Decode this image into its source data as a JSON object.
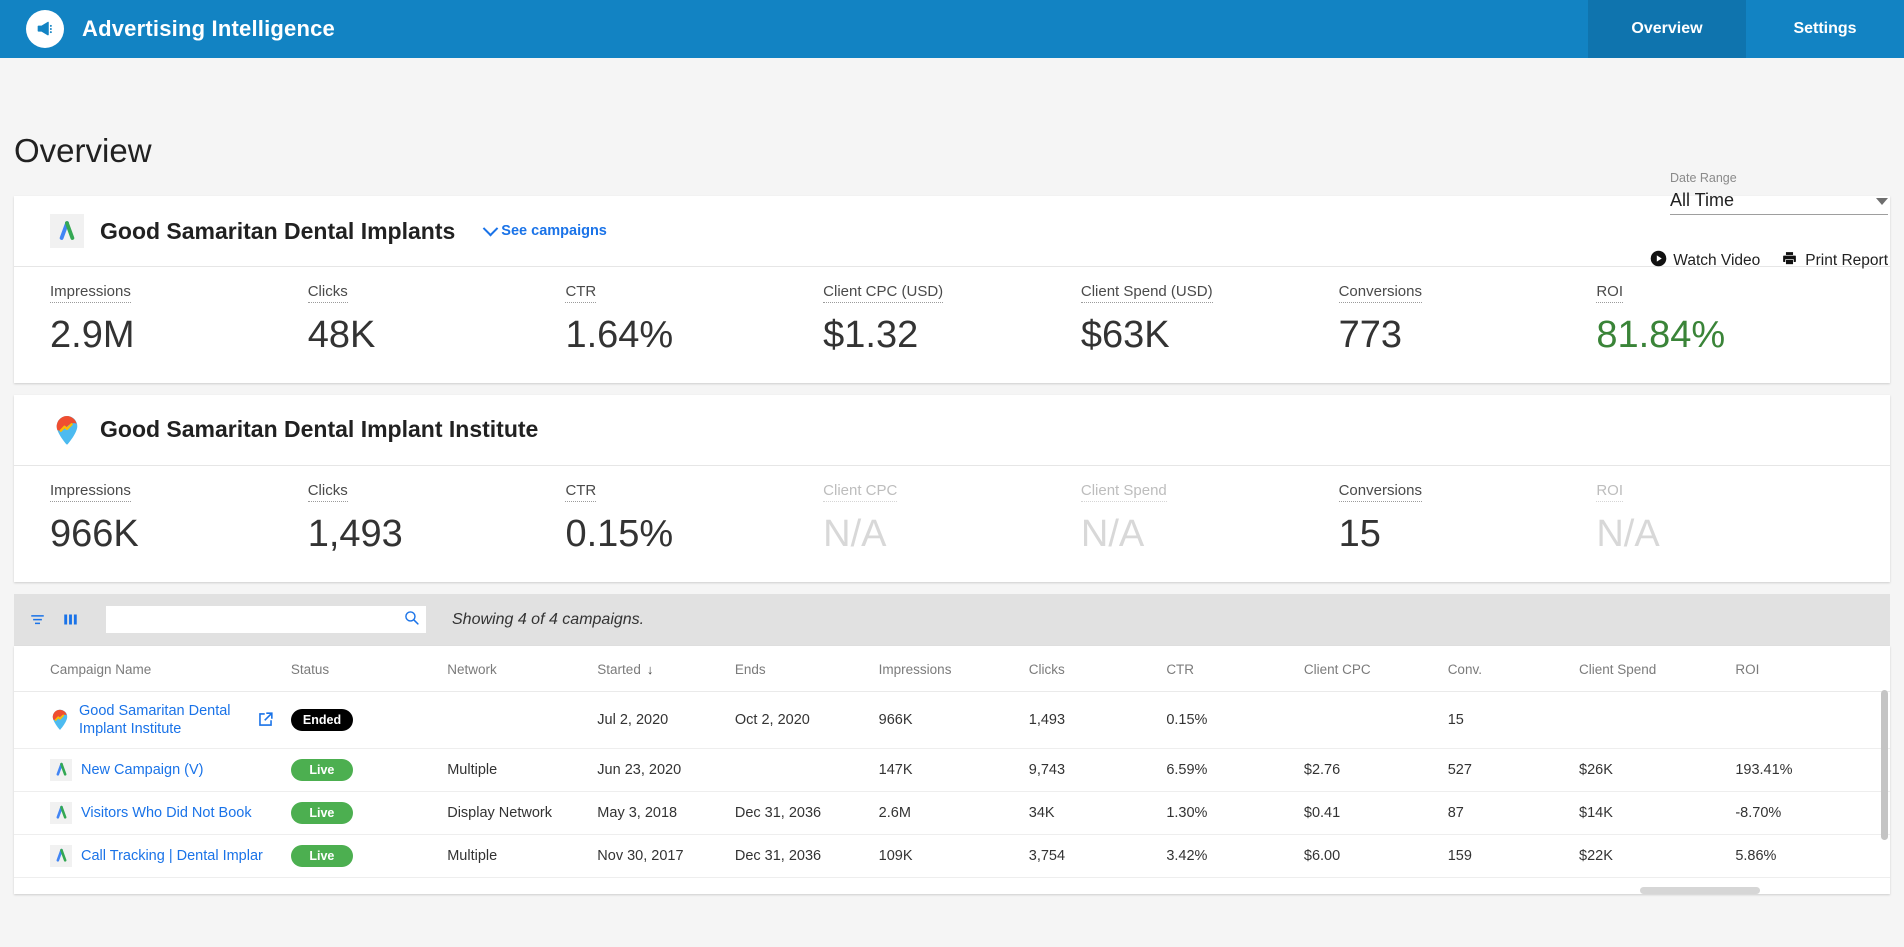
{
  "app": {
    "brand_title": "Advertising Intelligence",
    "logo_icon": "megaphone-icon",
    "accent_color": "#1283c3",
    "nav": [
      {
        "label": "Overview",
        "active": true
      },
      {
        "label": "Settings",
        "active": false
      }
    ]
  },
  "page": {
    "title": "Overview",
    "date_range": {
      "label": "Date Range",
      "value": "All Time",
      "caret_icon": "chevron-down-icon"
    },
    "actions": [
      {
        "label": "Watch Video",
        "icon": "play-circle-icon"
      },
      {
        "label": "Print Report",
        "icon": "printer-icon"
      }
    ]
  },
  "accounts": [
    {
      "name": "Good Samaritan Dental Implants",
      "icon": "google-ads-icon",
      "see_campaigns_label": "See campaigns",
      "metrics": [
        {
          "label": "Impressions",
          "value": "2.9M",
          "state": "normal"
        },
        {
          "label": "Clicks",
          "value": "48K",
          "state": "normal"
        },
        {
          "label": "CTR",
          "value": "1.64%",
          "state": "normal"
        },
        {
          "label": "Client CPC (USD)",
          "value": "$1.32",
          "state": "normal"
        },
        {
          "label": "Client Spend (USD)",
          "value": "$63K",
          "state": "normal"
        },
        {
          "label": "Conversions",
          "value": "773",
          "state": "normal"
        },
        {
          "label": "ROI",
          "value": "81.84%",
          "state": "positive"
        }
      ]
    },
    {
      "name": "Good Samaritan Dental Implant Institute",
      "icon": "map-pin-icon",
      "see_campaigns_label": "",
      "metrics": [
        {
          "label": "Impressions",
          "value": "966K",
          "state": "normal"
        },
        {
          "label": "Clicks",
          "value": "1,493",
          "state": "normal"
        },
        {
          "label": "CTR",
          "value": "0.15%",
          "state": "normal"
        },
        {
          "label": "Client CPC",
          "value": "N/A",
          "state": "na"
        },
        {
          "label": "Client Spend",
          "value": "N/A",
          "state": "na"
        },
        {
          "label": "Conversions",
          "value": "15",
          "state": "normal"
        },
        {
          "label": "ROI",
          "value": "N/A",
          "state": "na"
        }
      ]
    }
  ],
  "toolbar": {
    "filter_icon": "filter-icon",
    "columns_icon": "columns-icon",
    "search_icon": "search-icon",
    "search_value": "",
    "search_placeholder": "",
    "showing_text": "Showing 4 of 4 campaigns."
  },
  "table": {
    "columns": [
      {
        "key": "name",
        "label": "Campaign Name"
      },
      {
        "key": "status",
        "label": "Status"
      },
      {
        "key": "net",
        "label": "Network"
      },
      {
        "key": "start",
        "label": "Started",
        "sorted": "desc",
        "sort_icon": "arrow-down-icon"
      },
      {
        "key": "ends",
        "label": "Ends"
      },
      {
        "key": "impr",
        "label": "Impressions"
      },
      {
        "key": "clicks",
        "label": "Clicks"
      },
      {
        "key": "ctr",
        "label": "CTR"
      },
      {
        "key": "cpc",
        "label": "Client CPC"
      },
      {
        "key": "conv",
        "label": "Conv."
      },
      {
        "key": "spend",
        "label": "Client Spend"
      },
      {
        "key": "roi",
        "label": "ROI"
      }
    ],
    "rows": [
      {
        "name": "Good Samaritan Dental Implant Institute",
        "icon": "map-pin-icon",
        "external_link_icon": "external-link-icon",
        "has_external_link": true,
        "wrap": true,
        "status": "Ended",
        "status_kind": "ended",
        "net": "",
        "start": "Jul 2, 2020",
        "ends": "Oct 2, 2020",
        "impr": "966K",
        "clicks": "1,493",
        "ctr": "0.15%",
        "cpc": "",
        "conv": "15",
        "spend": "",
        "roi": ""
      },
      {
        "name": "New Campaign (V)",
        "icon": "google-ads-icon",
        "external_link_icon": "",
        "has_external_link": false,
        "wrap": false,
        "status": "Live",
        "status_kind": "live",
        "net": "Multiple",
        "start": "Jun 23, 2020",
        "ends": "",
        "impr": "147K",
        "clicks": "9,743",
        "ctr": "6.59%",
        "cpc": "$2.76",
        "conv": "527",
        "spend": "$26K",
        "roi": "193.41%"
      },
      {
        "name": "Visitors Who Did Not Book",
        "icon": "google-ads-icon",
        "external_link_icon": "",
        "has_external_link": false,
        "wrap": false,
        "status": "Live",
        "status_kind": "live",
        "net": "Display Network",
        "start": "May 3, 2018",
        "ends": "Dec 31, 2036",
        "impr": "2.6M",
        "clicks": "34K",
        "ctr": "1.30%",
        "cpc": "$0.41",
        "conv": "87",
        "spend": "$14K",
        "roi": "-8.70%"
      },
      {
        "name": "Call Tracking | Dental Implar",
        "icon": "google-ads-icon",
        "external_link_icon": "",
        "has_external_link": false,
        "wrap": false,
        "status": "Live",
        "status_kind": "live",
        "net": "Multiple",
        "start": "Nov 30, 2017",
        "ends": "Dec 31, 2036",
        "impr": "109K",
        "clicks": "3,754",
        "ctr": "3.42%",
        "cpc": "$6.00",
        "conv": "159",
        "spend": "$22K",
        "roi": "5.86%"
      }
    ]
  }
}
